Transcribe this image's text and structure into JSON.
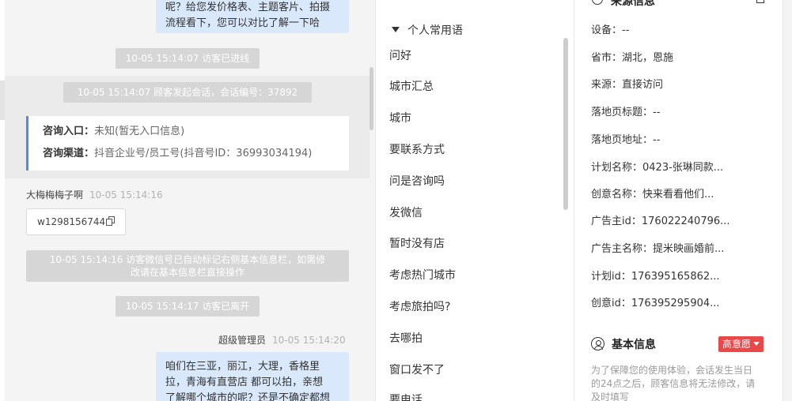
{
  "chat": {
    "top_bubble_lines": [
      "呢？给您发价格表、主题客片、拍摄",
      "流程看下，您可以对比了解一下哈"
    ],
    "sys_visitor_enter": "10-05 15:14:07 访客已进线",
    "sys_session_start": "10-05 15:14:07 顾客发起会话，会话编号：37892",
    "card": {
      "entry_label": "咨询入口：",
      "entry_value": "未知(暂无入口信息)",
      "channel_label": "咨询渠道：",
      "channel_value": "抖音企业号/员工号(抖音号ID：36993034194)"
    },
    "customer_name": "大梅梅梅子啊",
    "customer_time": "10-05 15:14:16",
    "wechat_id": "w1298156744",
    "sys_wechat_marked_lines": [
      "10-05 15:14:16 访客微信号已自动标记右侧基本信息栏，如需修",
      "改请在基本信息栏直接操作"
    ],
    "sys_visitor_leave": "10-05 15:14:17 访客已离开",
    "agent_name": "超级管理员",
    "agent_time": "10-05 15:14:20",
    "agent_msg_lines": [
      "咱们在三亚，丽江，大理，香格里",
      "拉，青海有直营店 都可以拍，亲想",
      "了解哪个城市的呢？还是不确定都想"
    ]
  },
  "phrases": {
    "header": "个人常用语",
    "items": [
      "问好",
      "城市汇总",
      "城市",
      "要联系方式",
      "问是咨询吗",
      "发微信",
      "暂时没有店",
      "考虑热门城市",
      "考虑旅拍吗?",
      "去哪拍",
      "窗口发不了",
      "要电话"
    ]
  },
  "source_info": {
    "header": "来源信息",
    "rows": [
      {
        "label": "设备：",
        "value": "--"
      },
      {
        "label": "省市：",
        "value": "湖北，恩施"
      },
      {
        "label": "来源：",
        "value": "直接访问"
      },
      {
        "label": "落地页标题：",
        "value": "--"
      },
      {
        "label": "落地页地址：",
        "value": "--"
      },
      {
        "label": "计划名称：",
        "value": "0423-张琳同款..."
      },
      {
        "label": "创意名称：",
        "value": "快来看看他们..."
      },
      {
        "label": "广告主id：",
        "value": "176022240796..."
      },
      {
        "label": "广告主名称：",
        "value": "提米映画婚前..."
      },
      {
        "label": "计划id：",
        "value": "176395165862..."
      },
      {
        "label": "创意id：",
        "value": "176395295904..."
      }
    ]
  },
  "basic_info": {
    "title": "基本信息",
    "intent_badge": "高意愿",
    "notice_lines": [
      "为了保障您的使用体验，会话发生当日",
      "的24点之后，顾客信息将无法修改，请",
      "及时填写"
    ]
  },
  "colors": {
    "accent_blue": "#4a8df0",
    "agent_bubble": "#d9e8fb",
    "badge_red": "#e94848",
    "system_msg_bg": "#d6d6d6"
  }
}
